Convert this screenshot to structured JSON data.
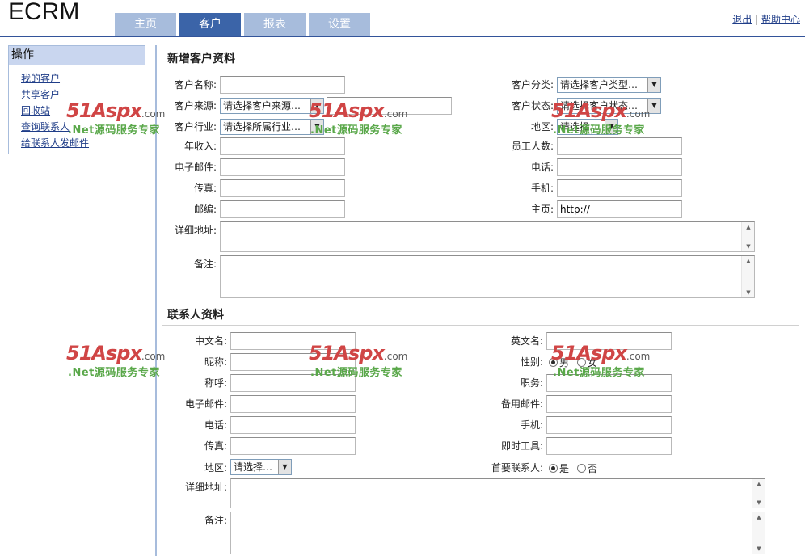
{
  "app": {
    "logo": "ECRM"
  },
  "tabs": [
    {
      "label": "主页"
    },
    {
      "label": "客户",
      "active": true
    },
    {
      "label": "报表"
    },
    {
      "label": "设置"
    }
  ],
  "top_links": {
    "logout": "退出",
    "separator": "|",
    "help": "帮助中心"
  },
  "sidebar": {
    "title": "操作",
    "items": [
      {
        "label": "我的客户"
      },
      {
        "label": "共享客户"
      },
      {
        "label": "回收站"
      },
      {
        "label": "查询联系人"
      },
      {
        "label": "给联系人发邮件"
      }
    ]
  },
  "customer": {
    "title": "新增客户资料",
    "name_label": "客户名称:",
    "category_label": "客户分类:",
    "category_value": "请选择客户类型…",
    "source_label": "客户来源:",
    "source_value": "请选择客户来源…",
    "status_label": "客户状态:",
    "status_value": "请选择客户状态…",
    "industry_label": "客户行业:",
    "industry_value": "请选择所属行业…",
    "region_label": "地区:",
    "region_value": "请选择…",
    "income_label": "年收入:",
    "employees_label": "员工人数:",
    "email_label": "电子邮件:",
    "phone_label": "电话:",
    "fax_label": "传真:",
    "mobile_label": "手机:",
    "zip_label": "邮编:",
    "homepage_label": "主页:",
    "homepage_value": "http://",
    "address_label": "详细地址:",
    "remark_label": "备注:"
  },
  "contact": {
    "title": "联系人资料",
    "cn_name_label": "中文名:",
    "en_name_label": "英文名:",
    "nickname_label": "昵称:",
    "gender_label": "性别:",
    "gender_male": "男",
    "gender_female": "女",
    "title_label": "称呼:",
    "position_label": "职务:",
    "email_label": "电子邮件:",
    "backup_email_label": "备用邮件:",
    "phone_label": "电话:",
    "mobile_label": "手机:",
    "fax_label": "传真:",
    "im_label": "即时工具:",
    "region_label": "地区:",
    "region_value": "请选择…",
    "primary_label": "首要联系人:",
    "primary_yes": "是",
    "primary_no": "否",
    "address_label": "详细地址:",
    "remark_label": "备注:"
  },
  "watermark": {
    "brand": "51Aspx",
    "domain": ".com",
    "slogan": ".Net源码服务专家"
  }
}
